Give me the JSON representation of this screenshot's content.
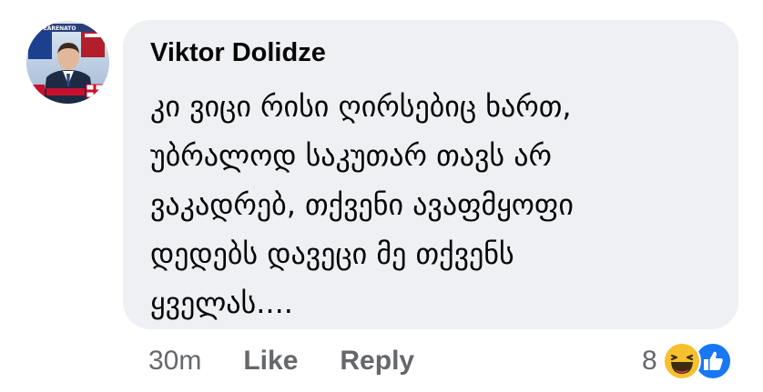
{
  "comment": {
    "author": "Viktor Dolidze",
    "lines": [
      "კი ვიცი რისი ღირსებიც ხართ,",
      "უბრალოდ საკუთარ თავს არ",
      "ვაკადრებ, თქვენი ავაფმყოფი",
      "დედებს დავეცი მე თქვენს",
      "ყველას...."
    ],
    "timestamp": "30m",
    "like_label": "Like",
    "reply_label": "Reply",
    "reaction_count": "8",
    "reactions": [
      "haha-icon",
      "like-icon"
    ],
    "avatar_badge_text": "WEARENATO"
  },
  "colors": {
    "bubble": "#eef0f3",
    "text": "#050505",
    "meta": "#65676b",
    "like_blue": "#1877f2",
    "haha_yellow": "#f7c02f"
  }
}
